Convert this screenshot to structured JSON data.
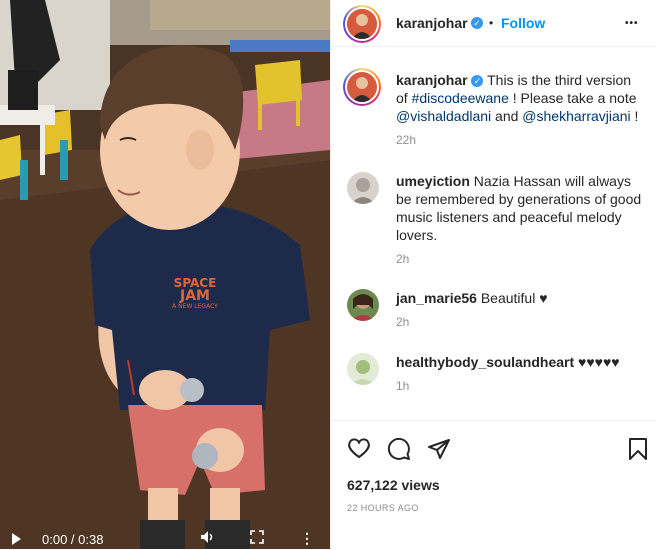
{
  "post": {
    "username": "karanjohar",
    "follow_label": "Follow",
    "separator": "•",
    "more_label": "•••",
    "verified_glyph": "✓"
  },
  "caption": {
    "username": "karanjohar",
    "text_1": "This is the third version of ",
    "hashtag": "#discodeewane",
    "text_2": " ! Please take a note ",
    "mention_1": "@vishaldadlani",
    "text_3": " and ",
    "mention_2": "@shekharravjiani",
    "text_4": " !",
    "time": "22h"
  },
  "comments": [
    {
      "username": "umeyiction",
      "text": "Nazia Hassan will always be remembered by generations of good music listeners and peaceful melody lovers.",
      "time": "2h"
    },
    {
      "username": "jan_marie56",
      "text": "Beautiful ♥",
      "time": "2h"
    },
    {
      "username": "healthybody_soulandheart",
      "text": "♥♥♥♥♥",
      "time": "1h"
    }
  ],
  "stats": {
    "views": "627,122 views",
    "posted_ago": "22 HOURS AGO"
  },
  "video": {
    "time": "0:00 / 0:38",
    "shirt_text_1": "SPACE",
    "shirt_text_2": "JAM",
    "shirt_text_3": "A NEW LEGACY"
  },
  "colors": {
    "follow": "#0095f6",
    "link": "#00376b",
    "muted": "#8e8e8e",
    "verified": "#3897f0"
  },
  "icons": [
    "heart-icon",
    "comment-icon",
    "share-icon",
    "bookmark-icon",
    "play-icon",
    "volume-icon",
    "fullscreen-icon",
    "more-icon",
    "verified-icon"
  ]
}
